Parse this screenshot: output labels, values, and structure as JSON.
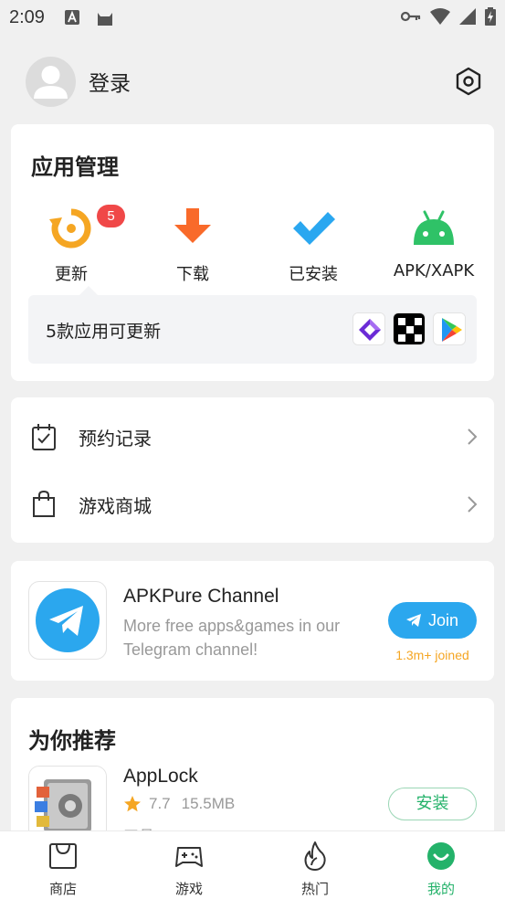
{
  "status_bar": {
    "time": "2:09"
  },
  "header": {
    "login_label": "登录"
  },
  "app_management": {
    "title": "应用管理",
    "items": [
      {
        "label": "更新",
        "icon": "update-icon"
      },
      {
        "label": "下载",
        "icon": "download-icon"
      },
      {
        "label": "已安装",
        "icon": "installed-check-icon"
      },
      {
        "label": "APK/XAPK",
        "icon": "android-icon"
      }
    ],
    "update_badge": "5",
    "update_text": "5款应用可更新"
  },
  "list": {
    "items": [
      {
        "label": "预约记录",
        "icon": "calendar-check-icon"
      },
      {
        "label": "游戏商城",
        "icon": "shopping-bag-icon"
      }
    ]
  },
  "telegram": {
    "title": "APKPure Channel",
    "description": "More free apps&games in our Telegram channel!",
    "join_label": "Join",
    "joined_count": "1.3m+ joined"
  },
  "recommend": {
    "title": "为你推荐",
    "app": {
      "name": "AppLock",
      "rating": "7.7",
      "size": "15.5MB",
      "category": "工具",
      "install_label": "安装"
    }
  },
  "bottom_nav": {
    "items": [
      {
        "label": "商店",
        "icon": "store-icon"
      },
      {
        "label": "游戏",
        "icon": "gamepad-icon"
      },
      {
        "label": "热门",
        "icon": "flame-icon"
      },
      {
        "label": "我的",
        "icon": "smile-icon",
        "active": true
      }
    ]
  },
  "colors": {
    "accent_green": "#24b26a",
    "update_orange": "#f5a623",
    "download_orange": "#f96a2a",
    "installed_blue": "#2aa7f0",
    "android_green": "#2fc267",
    "telegram_blue": "#2ba7ee",
    "badge_red": "#f04848"
  }
}
